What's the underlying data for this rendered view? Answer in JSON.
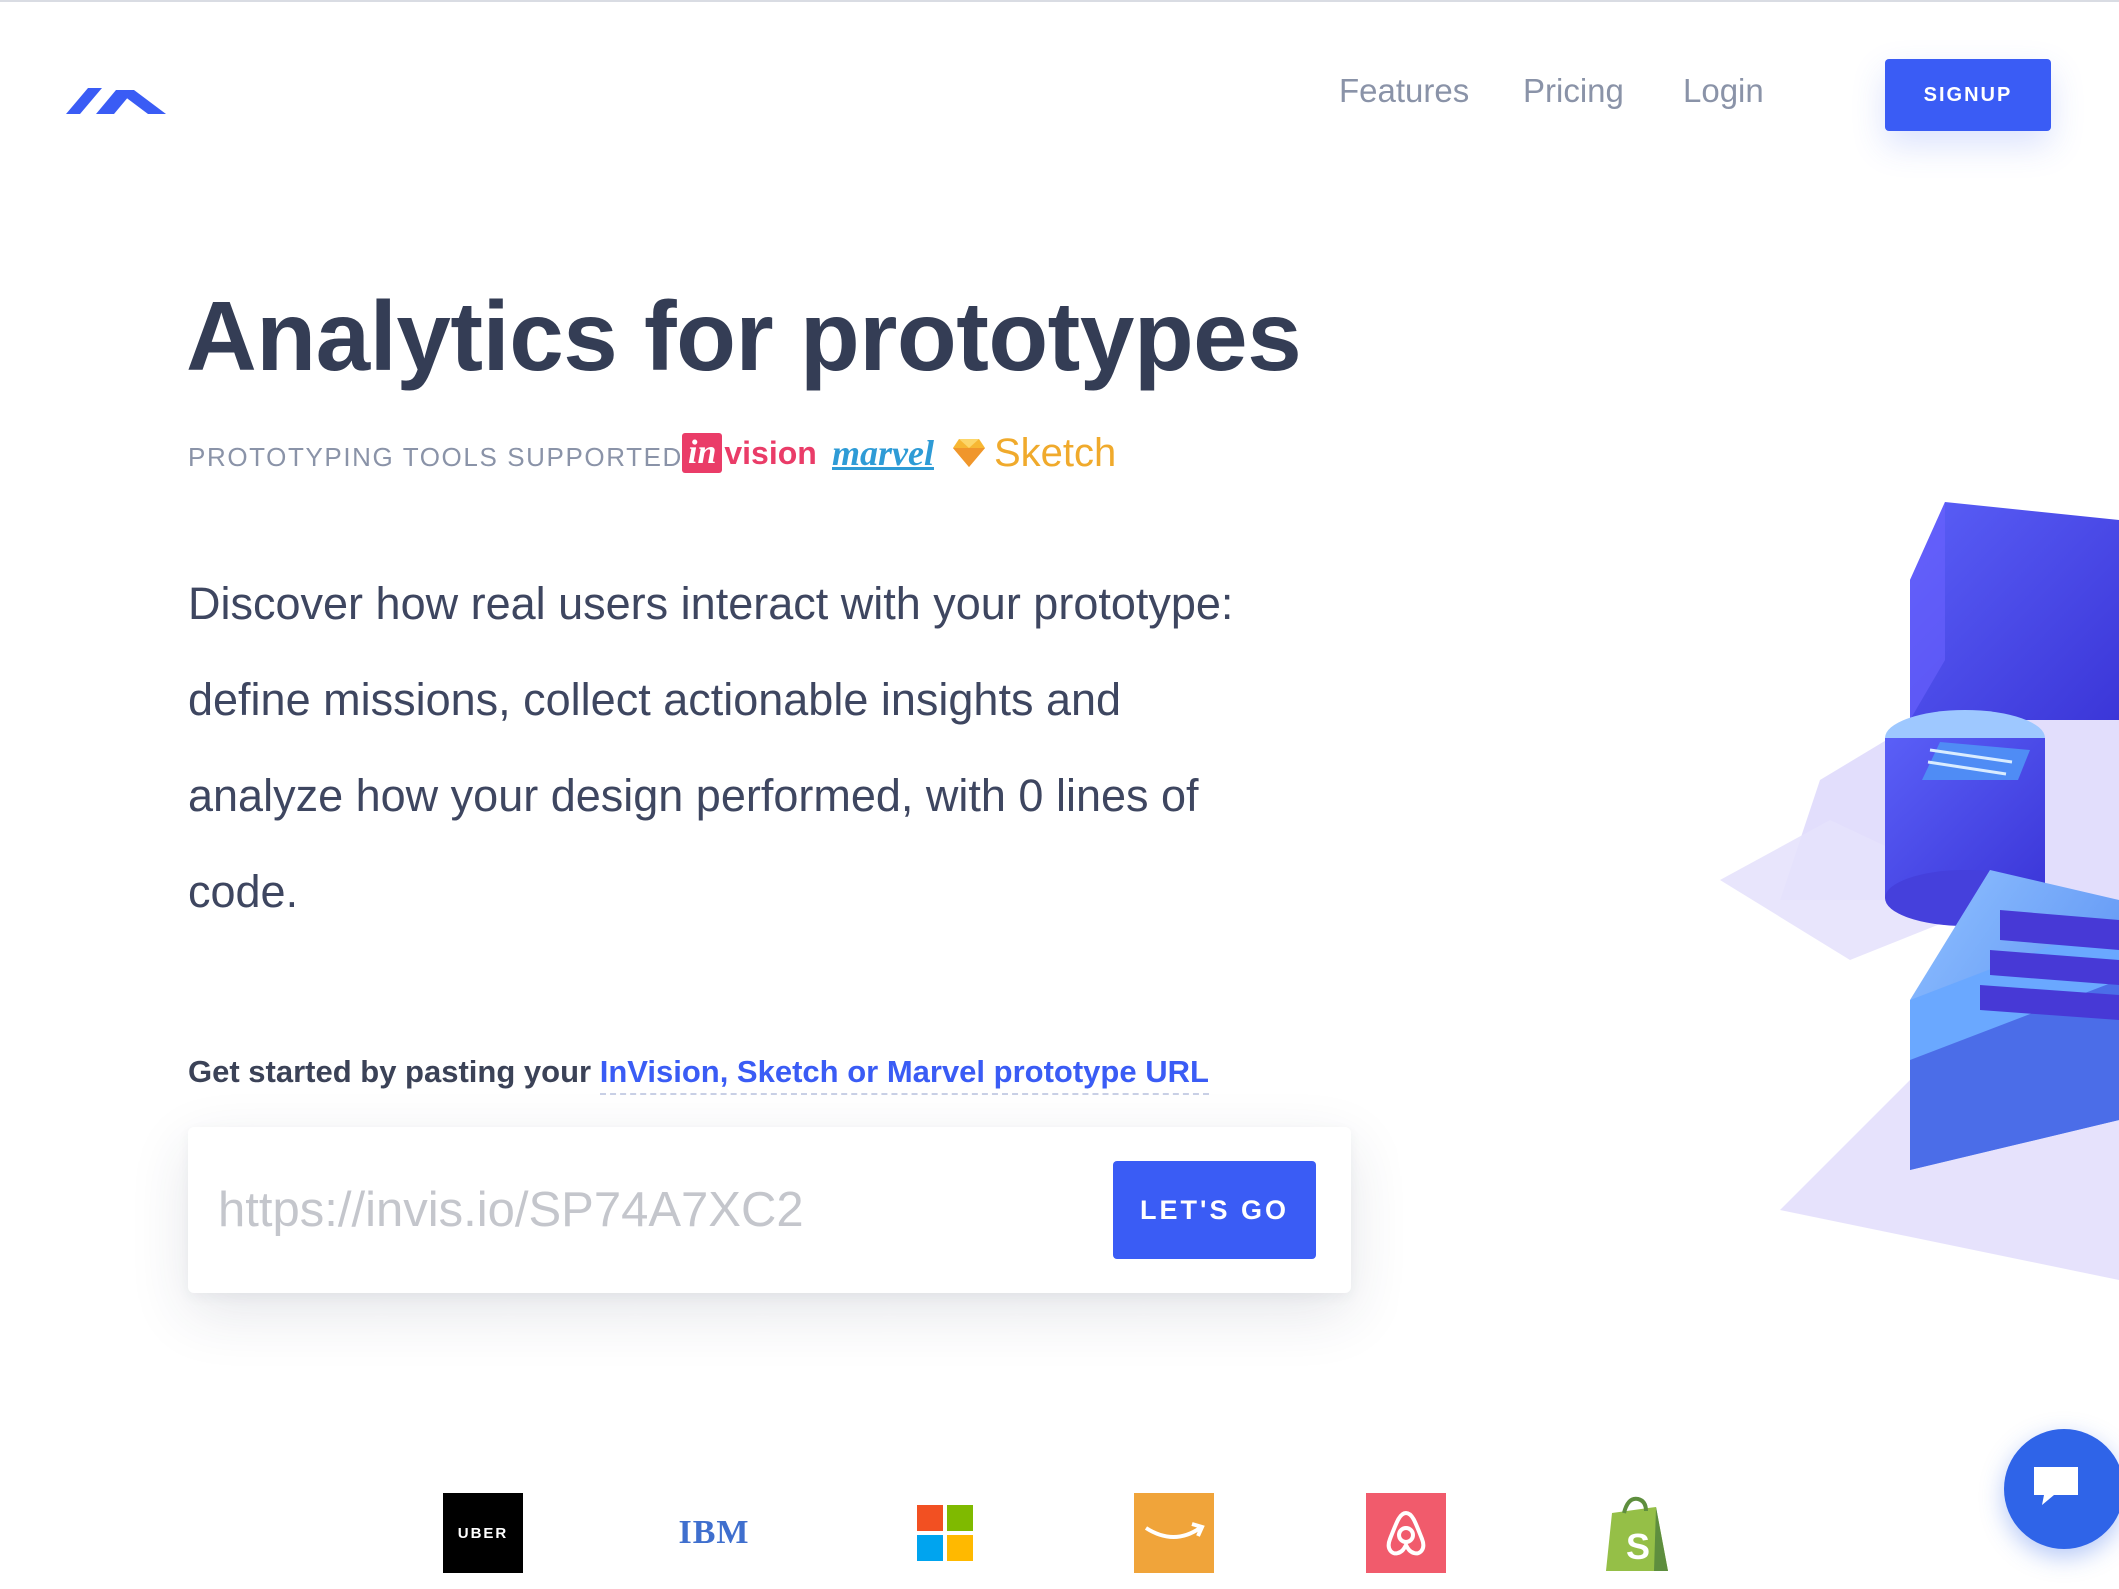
{
  "header": {
    "nav": [
      "Features",
      "Pricing",
      "Login"
    ],
    "signup_label": "SIGNUP"
  },
  "hero": {
    "title": "Analytics for prototypes",
    "tools_label": "PROTOTYPING TOOLS SUPPORTED",
    "tools": {
      "invision_a": "in",
      "invision_b": "vision",
      "marvel": "marvel",
      "sketch": "Sketch"
    },
    "description": "Discover how real users interact with your prototype:\ndefine missions, collect actionable insights and\nanalyze how your design performed, with 0 lines of\ncode."
  },
  "cta": {
    "lead": "Get started by pasting your ",
    "link": "InVision, Sketch or Marvel prototype URL",
    "input_placeholder": "https://invis.io/SP74A7XC2",
    "button_label": "LET'S GO"
  },
  "customers": {
    "uber": "UBER",
    "ibm": "IBM"
  },
  "colors": {
    "accent": "#3a5cf5",
    "title": "#343d55",
    "muted": "#8a93a8"
  },
  "icons": [
    "logo-icon",
    "sketch-diamond-icon",
    "microsoft-logo-icon",
    "amazon-smile-icon",
    "airbnb-logo-icon",
    "shopify-bag-icon",
    "chat-icon"
  ]
}
